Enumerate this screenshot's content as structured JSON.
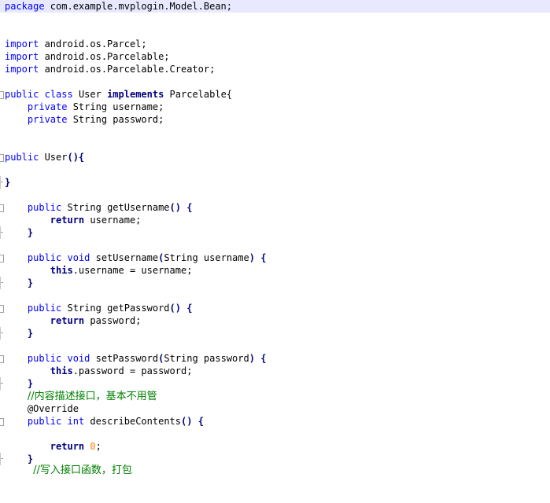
{
  "lines": {
    "l0": [
      "package",
      " com.example.mvplogin.Model.Bean;"
    ],
    "l3": [
      "import",
      " android.os.Parcel;"
    ],
    "l4": [
      "import",
      " android.os.Parcelable;"
    ],
    "l5": [
      "import",
      " android.os.Parcelable.Creator;"
    ],
    "l7": [
      "public",
      " ",
      "class",
      " User ",
      "implements",
      " Parcelable{"
    ],
    "l8": [
      "    ",
      "private",
      " String username;"
    ],
    "l9": [
      "    ",
      "private",
      " String password;"
    ],
    "l12": [
      "public",
      " User",
      "(){"
    ],
    "l14": [
      "}"
    ],
    "l16": [
      "    ",
      "public",
      " String getUsername",
      "()",
      " ",
      "{"
    ],
    "l17": [
      "        ",
      "return",
      " username;"
    ],
    "l18": [
      "    ",
      "}"
    ],
    "l20": [
      "    ",
      "public",
      " ",
      "void",
      " setUsername",
      "(",
      "String username",
      ")",
      " ",
      "{"
    ],
    "l21": [
      "        ",
      "this",
      ".username = username;"
    ],
    "l22": [
      "    ",
      "}"
    ],
    "l24": [
      "    ",
      "public",
      " String getPassword",
      "()",
      " ",
      "{"
    ],
    "l25": [
      "        ",
      "return",
      " password;"
    ],
    "l26": [
      "    ",
      "}"
    ],
    "l28": [
      "    ",
      "public",
      " ",
      "void",
      " setPassword",
      "(",
      "String password",
      ")",
      " ",
      "{"
    ],
    "l29": [
      "        ",
      "this",
      ".password = password;"
    ],
    "l30": [
      "    ",
      "}"
    ],
    "l31": [
      "    ",
      "//内容描述接口，基本不用管"
    ],
    "l32": [
      "    ",
      "@Override"
    ],
    "l33": [
      "    ",
      "public",
      " ",
      "int",
      " describeContents",
      "()",
      " ",
      "{"
    ],
    "l35": [
      "        ",
      "return",
      " ",
      "0",
      ";"
    ],
    "l36": [
      "    ",
      "}"
    ],
    "l37": [
      "     ",
      "//写入接口函数，打包"
    ]
  },
  "colors": {
    "keyword": "#0000ff",
    "keyword_bold": "#000080",
    "number": "#ff8000",
    "comment": "#008000",
    "current_line": "#e8e8ff"
  }
}
